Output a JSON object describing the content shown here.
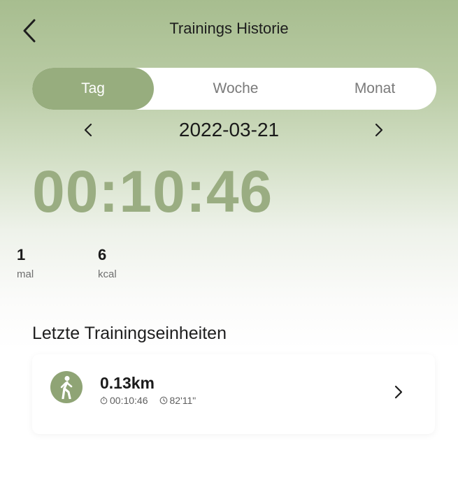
{
  "header": {
    "title": "Trainings Historie",
    "back_icon": "chevron-left-icon"
  },
  "period_tabs": {
    "items": [
      "Tag",
      "Woche",
      "Monat"
    ],
    "selected": "Tag"
  },
  "date_nav": {
    "date": "2022-03-21",
    "prev_icon": "chevron-left-icon",
    "next_icon": "chevron-right-icon"
  },
  "summary": {
    "duration": "00:10:46",
    "count_value": "1",
    "count_unit": "mal",
    "calories_value": "6",
    "calories_unit": "kcal"
  },
  "recent": {
    "title": "Letzte Trainingseinheiten",
    "items": [
      {
        "icon": "walking-icon",
        "distance": "0.13km",
        "duration": "00:10:46",
        "pace": "82'11\""
      }
    ]
  },
  "colors": {
    "accent": "#97ad7e",
    "timer_text": "#9aad82",
    "icon_bg": "#8fa475"
  }
}
